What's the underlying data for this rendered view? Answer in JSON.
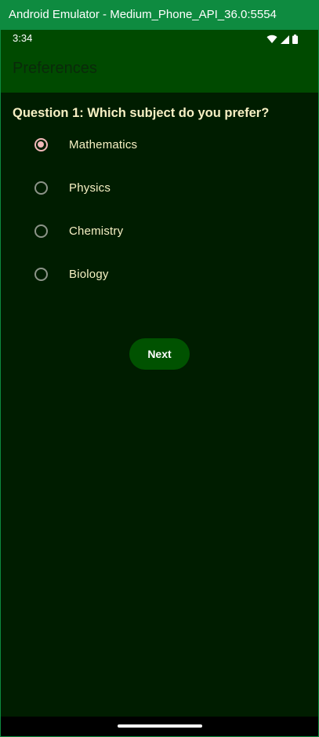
{
  "window": {
    "title": "Android Emulator - Medium_Phone_API_36.0:5554"
  },
  "status_bar": {
    "time": "3:34",
    "icons": [
      "wifi-icon",
      "signal-icon",
      "battery-icon"
    ]
  },
  "app_bar": {
    "title": "Preferences"
  },
  "quiz": {
    "question": "Question 1: Which subject do you prefer?",
    "options": [
      {
        "label": "Mathematics",
        "selected": true
      },
      {
        "label": "Physics",
        "selected": false
      },
      {
        "label": "Chemistry",
        "selected": false
      },
      {
        "label": "Biology",
        "selected": false
      }
    ],
    "next_label": "Next"
  },
  "colors": {
    "app_bar_bg": "#004a00",
    "screen_bg": "#001d00",
    "text": "#f7f0c4",
    "radio_selected": "#f0b8b8",
    "button_bg": "#005200"
  }
}
